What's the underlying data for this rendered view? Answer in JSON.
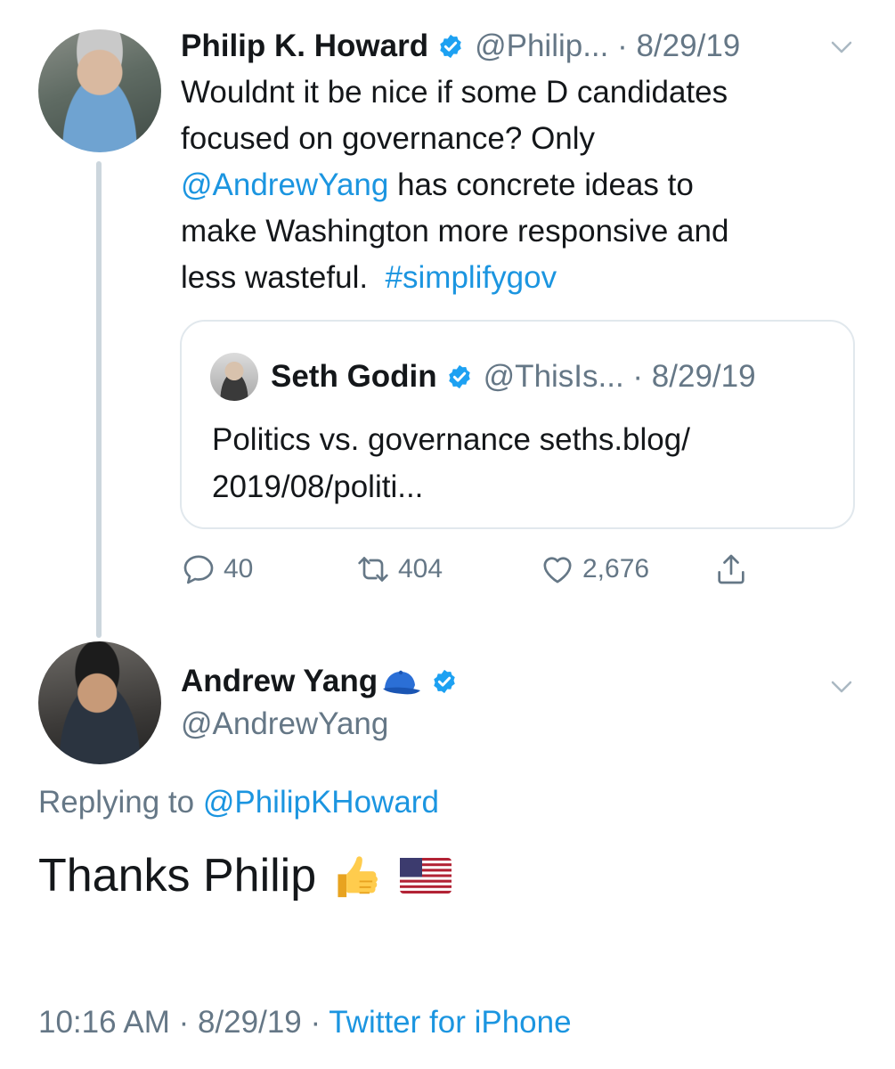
{
  "colors": {
    "link": "#1b95e0",
    "text_primary": "#14171a",
    "text_secondary": "#657786",
    "border": "#e1e8ed",
    "thread_line": "#ccd6dd"
  },
  "parent_tweet": {
    "author_name": "Philip K. Howard",
    "handle_and_date": "@Philip... · 8/29/19",
    "text_lines": {
      "line1": "Wouldnt it be nice if some D candidates",
      "line2": "focused on governance? Only",
      "mention": "@AndrewYang",
      "line3_rest": " has concrete ideas to",
      "line4": "make Washington more responsive and",
      "line5": "less wasteful.  ",
      "hashtag": "#simplifygov"
    },
    "quoted_tweet": {
      "author_name": "Seth Godin",
      "handle_and_date": "@ThisIs... · 8/29/19",
      "text_line1": "Politics vs. governance seths.blog/",
      "text_line2": "2019/08/politi..."
    },
    "actions": {
      "replies": "40",
      "retweets": "404",
      "likes": "2,676"
    }
  },
  "reply_tweet": {
    "author_name": "Andrew Yang",
    "handle": "@AndrewYang",
    "replying_prefix": "Replying to ",
    "replying_handle": "@PhilipKHoward",
    "text": "Thanks Philip",
    "emojis": [
      "thumbs-up",
      "us-flag"
    ],
    "timestamp": "10:16 AM · 8/29/19 · ",
    "source": "Twitter for iPhone"
  },
  "icons": [
    "verified-badge-icon",
    "chevron-down-icon",
    "reply-icon",
    "retweet-icon",
    "heart-icon",
    "share-icon",
    "cap-emoji-icon"
  ]
}
